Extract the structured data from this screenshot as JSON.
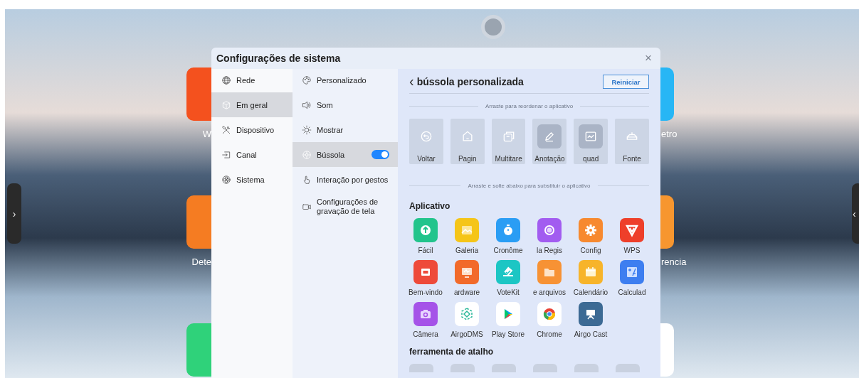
{
  "desktop": {
    "left_icons": [
      {
        "label": "W",
        "color": "#f4511e"
      },
      {
        "label": "Dete",
        "color": "#f57c22"
      },
      {
        "color": "#2fd27a"
      }
    ],
    "right_icons": [
      {
        "label": "etro",
        "color": "#27b6f5"
      },
      {
        "label": "rencia",
        "color": "#f7962f"
      },
      {
        "color": "#ffffff"
      }
    ],
    "left_handle": "›",
    "right_handle": "‹"
  },
  "dialog": {
    "title": "Configurações de sistema",
    "close": "×",
    "categories": [
      {
        "label": "Rede",
        "kind": "globe",
        "selected": false
      },
      {
        "label": "Em geral",
        "kind": "cube",
        "selected": true
      },
      {
        "label": "Dispositivo",
        "kind": "tools",
        "selected": false
      },
      {
        "label": "Canal",
        "kind": "input",
        "selected": false
      },
      {
        "label": "Sistema",
        "kind": "flower",
        "selected": false
      }
    ],
    "settings": [
      {
        "label": "Personalizado",
        "kind": "palette",
        "selected": false
      },
      {
        "label": "Som",
        "kind": "speaker",
        "selected": false
      },
      {
        "label": "Mostrar",
        "kind": "sun",
        "selected": false
      },
      {
        "label": "Bússola",
        "kind": "wheel",
        "selected": true,
        "switch_on": true
      },
      {
        "label": "Interação por gestos",
        "kind": "hand",
        "selected": false
      },
      {
        "label": "Configurações de gravação de tela",
        "kind": "camera",
        "selected": false
      }
    ],
    "panel": {
      "back": "‹",
      "title": "bússola personalizada",
      "reset_button": "Reiniciar",
      "reorder_hint": "Arraste para reordenar o aplicativo",
      "compass_tiles": [
        {
          "label": "Voltar",
          "kind": "back",
          "active": false
        },
        {
          "label": "Pagin",
          "kind": "home",
          "active": false
        },
        {
          "label": "Multitare",
          "kind": "windows",
          "active": false
        },
        {
          "label": "Anotação",
          "kind": "pen",
          "active": true
        },
        {
          "label": "quad",
          "kind": "board",
          "active": true
        },
        {
          "label": "Fonte",
          "kind": "source",
          "active": false
        }
      ],
      "replace_hint": "Arraste e solte abaixo para substituir o aplicativo",
      "apps_heading": "Aplicativo",
      "apps": [
        {
          "label": "Fácil",
          "kind": "upload",
          "color": "#22c48c"
        },
        {
          "label": "Galeria",
          "kind": "image",
          "color": "#f5c518"
        },
        {
          "label": "Cronôme",
          "kind": "timer",
          "color": "#2a9df4"
        },
        {
          "label": "la   Regis",
          "kind": "record",
          "color": "#a25cf0"
        },
        {
          "label": "Config",
          "kind": "gear",
          "color": "#f7892f"
        },
        {
          "label": "WPS",
          "kind": "wps",
          "color": "#ee3f2a"
        },
        {
          "label": "Bem-vindo",
          "kind": "hi",
          "color": "#ee4a3a"
        },
        {
          "label": "ardware",
          "kind": "monitor",
          "color": "#f26a2a"
        },
        {
          "label": "VoteKit",
          "kind": "vote",
          "color": "#1cc6c4"
        },
        {
          "label": "e arquivos",
          "kind": "folder",
          "color": "#f79234"
        },
        {
          "label": "Calendário",
          "kind": "calendar",
          "color": "#f7b42a"
        },
        {
          "label": "Calculad",
          "kind": "calc",
          "color": "#3d7ef0"
        },
        {
          "label": "Câmera",
          "kind": "camera",
          "color": "#a553e8"
        },
        {
          "label": "AirgoDMS",
          "kind": "dms",
          "color": "#ffffff"
        },
        {
          "label": "Play Store",
          "kind": "play",
          "color": "#ffffff"
        },
        {
          "label": "Chrome",
          "kind": "chrome",
          "color": "#ffffff"
        },
        {
          "label": "Airgo Cast",
          "kind": "cast",
          "color": "#3c6a94"
        }
      ],
      "shortcuts_heading": "ferramenta de atalho"
    }
  }
}
